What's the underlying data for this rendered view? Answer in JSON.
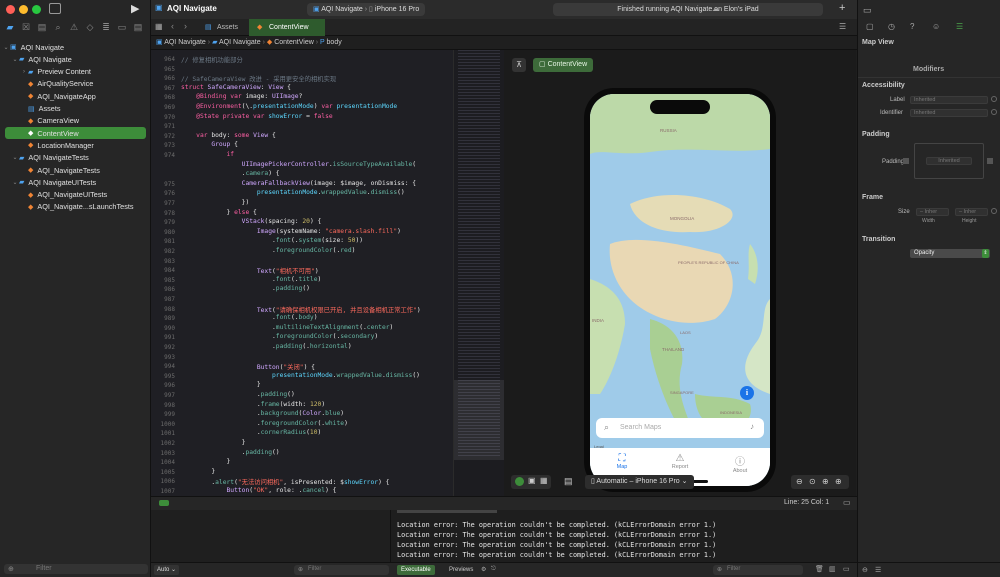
{
  "window": {
    "scheme": "AQI Navigate",
    "breadcrumb_project": "AQI Navigate",
    "device": "iPhone 16 Pro",
    "status": "Finished running AQI Navigate on Elon's iPad"
  },
  "sidebar": {
    "items": [
      {
        "label": "AQI Navigate",
        "level": 0,
        "kind": "project"
      },
      {
        "label": "AQI Navigate",
        "level": 1,
        "kind": "folder"
      },
      {
        "label": "Preview Content",
        "level": 2,
        "kind": "folder"
      },
      {
        "label": "AirQualityService",
        "level": 2,
        "kind": "swift"
      },
      {
        "label": "AQI_NavigateApp",
        "level": 2,
        "kind": "swift"
      },
      {
        "label": "Assets",
        "level": 2,
        "kind": "assets"
      },
      {
        "label": "CameraView",
        "level": 2,
        "kind": "swift"
      },
      {
        "label": "ContentView",
        "level": 2,
        "kind": "swift",
        "selected": true
      },
      {
        "label": "LocationManager",
        "level": 2,
        "kind": "swift"
      },
      {
        "label": "AQI NavigateTests",
        "level": 1,
        "kind": "folder"
      },
      {
        "label": "AQI_NavigateTests",
        "level": 2,
        "kind": "swift"
      },
      {
        "label": "AQI NavigateUITests",
        "level": 1,
        "kind": "folder"
      },
      {
        "label": "AQI_NavigateUITests",
        "level": 2,
        "kind": "swift"
      },
      {
        "label": "AQI_Navigate...sLaunchTests",
        "level": 2,
        "kind": "swift"
      }
    ],
    "filter_placeholder": "Filter"
  },
  "tabs": [
    {
      "label": "Assets"
    },
    {
      "label": "ContentView",
      "active": true
    }
  ],
  "jumpbar": [
    "AQI Navigate",
    "AQI Navigate",
    "ContentView",
    "body"
  ],
  "editor": {
    "lines": [
      {
        "n": "964",
        "html": "<span class='cm'>// 修复相机功能部分</span>"
      },
      {
        "n": "965",
        "html": ""
      },
      {
        "n": "966",
        "html": "<span class='cm'>// SafeCameraView 改进 - 采用更安全的相机实现</span>"
      },
      {
        "n": "967",
        "html": "<span class='kw'>struct</span> <span class='ty'>SafeCameraView</span>: <span class='ty'>View</span> {"
      },
      {
        "n": "968",
        "html": "    <span class='kw'>@Binding var</span> image: <span class='ty'>UIImage</span>?"
      },
      {
        "n": "969",
        "html": "    <span class='kw'>@Environment</span>(\\.<span class='pr'>presentationMode</span>) <span class='kw'>var</span> <span class='pr'>presentationMode</span>"
      },
      {
        "n": "970",
        "html": "    <span class='kw'>@State private var</span> <span class='pr'>showError</span> = <span class='kw'>false</span>"
      },
      {
        "n": "971",
        "html": ""
      },
      {
        "n": "972",
        "html": "    <span class='kw'>var</span> body: <span class='kw'>some</span> <span class='ty'>View</span> {"
      },
      {
        "n": "973",
        "html": "        <span class='ty'>Group</span> {"
      },
      {
        "n": "974",
        "html": "            <span class='kw'>if</span>"
      },
      {
        "n": "",
        "html": "                <span class='ty'>UIImagePickerController</span>.<span class='fn'>isSourceTypeAvailable</span>("
      },
      {
        "n": "",
        "html": "                .<span class='fn'>camera</span>) {"
      },
      {
        "n": "975",
        "html": "                <span class='ty'>CameraFallbackView</span>(image: $image, onDismiss: {"
      },
      {
        "n": "976",
        "html": "                    <span class='pr'>presentationMode</span>.<span class='fn'>wrappedValue</span>.<span class='fn'>dismiss</span>()"
      },
      {
        "n": "977",
        "html": "                })"
      },
      {
        "n": "978",
        "html": "            } <span class='kw'>else</span> {"
      },
      {
        "n": "979",
        "html": "                <span class='ty'>VStack</span>(spacing: <span class='nu'>20</span>) {"
      },
      {
        "n": "980",
        "html": "                    <span class='ty'>Image</span>(systemName: <span class='st'>\"camera.slash.fill\"</span>)"
      },
      {
        "n": "981",
        "html": "                        .<span class='fn'>font</span>(.<span class='fn'>system</span>(size: <span class='nu'>50</span>))"
      },
      {
        "n": "982",
        "html": "                        .<span class='fn'>foregroundColor</span>(.<span class='fn'>red</span>)"
      },
      {
        "n": "983",
        "html": ""
      },
      {
        "n": "984",
        "html": "                    <span class='ty'>Text</span>(<span class='st'>\"相机不可用\"</span>)"
      },
      {
        "n": "985",
        "html": "                        .<span class='fn'>font</span>(.<span class='fn'>title</span>)"
      },
      {
        "n": "986",
        "html": "                        .<span class='fn'>padding</span>()"
      },
      {
        "n": "987",
        "html": ""
      },
      {
        "n": "988",
        "html": "                    <span class='ty'>Text</span>(<span class='st'>\"请确保相机权限已开启, 并且设备相机正常工作\"</span>)"
      },
      {
        "n": "989",
        "html": "                        .<span class='fn'>font</span>(.<span class='fn'>body</span>)"
      },
      {
        "n": "990",
        "html": "                        .<span class='fn'>multilineTextAlignment</span>(.<span class='fn'>center</span>)"
      },
      {
        "n": "991",
        "html": "                        .<span class='fn'>foregroundColor</span>(.<span class='fn'>secondary</span>)"
      },
      {
        "n": "992",
        "html": "                        .<span class='fn'>padding</span>(.<span class='fn'>horizontal</span>)"
      },
      {
        "n": "993",
        "html": ""
      },
      {
        "n": "994",
        "html": "                    <span class='ty'>Button</span>(<span class='st'>\"关闭\"</span>) {"
      },
      {
        "n": "995",
        "html": "                        <span class='pr'>presentationMode</span>.<span class='fn'>wrappedValue</span>.<span class='fn'>dismiss</span>()"
      },
      {
        "n": "996",
        "html": "                    }"
      },
      {
        "n": "997",
        "html": "                    .<span class='fn'>padding</span>()"
      },
      {
        "n": "998",
        "html": "                    .<span class='fn'>frame</span>(width: <span class='nu'>120</span>)"
      },
      {
        "n": "999",
        "html": "                    .<span class='fn'>background</span>(<span class='ty'>Color</span>.<span class='fn'>blue</span>)"
      },
      {
        "n": "1000",
        "html": "                    .<span class='fn'>foregroundColor</span>(.<span class='fn'>white</span>)"
      },
      {
        "n": "1001",
        "html": "                    .<span class='fn'>cornerRadius</span>(<span class='nu'>10</span>)"
      },
      {
        "n": "1002",
        "html": "                }"
      },
      {
        "n": "1003",
        "html": "                .<span class='fn'>padding</span>()"
      },
      {
        "n": "1004",
        "html": "            }"
      },
      {
        "n": "1005",
        "html": "        }"
      },
      {
        "n": "1006",
        "html": "        .<span class='fn'>alert</span>(<span class='st'>\"无法访问相机\"</span>, isPresented: $<span class='pr'>showError</span>) {"
      },
      {
        "n": "1007",
        "html": "            <span class='ty'>Button</span>(<span class='st'>\"OK\"</span>, role: .<span class='fn'>cancel</span>) {"
      }
    ]
  },
  "canvas": {
    "preview_chip": "ContentView",
    "device_selector": "Automatic – iPhone 16 Pro"
  },
  "phone": {
    "labels": [
      "RUSSIA",
      "MONGOLIA",
      "PEOPLE'S REPUBLIC OF CHINA",
      "INDIA",
      "LAOS",
      "THAILAND",
      "SINGAPORE",
      "INDONESIA"
    ],
    "search_placeholder": "Search Maps",
    "legal": "Legal",
    "tabs": [
      "Map",
      "Report",
      "About"
    ]
  },
  "inspector": {
    "title": "Map View",
    "modifiers": "Modifiers",
    "accessibility": "Accessibility",
    "label": "Label",
    "identifier": "Identifier",
    "inherited": "Inherited",
    "padding_section": "Padding",
    "padding_label": "Padding",
    "frame_section": "Frame",
    "size_label": "Size",
    "inherit": "Inher",
    "width": "Width",
    "height": "Height",
    "transition_section": "Transition",
    "transition_value": "Opacity"
  },
  "status": {
    "line_col": "Line: 25  Col: 1",
    "auto": "Auto",
    "filter": "Filter",
    "executable": "Executable",
    "previews": "Previews"
  },
  "console": {
    "lines": [
      "Location error: The operation couldn't be completed. (kCLErrorDomain error 1.)",
      "Location error: The operation couldn't be completed. (kCLErrorDomain error 1.)",
      "Location error: The operation couldn't be completed. (kCLErrorDomain error 1.)",
      "Location error: The operation couldn't be completed. (kCLErrorDomain error 1.)"
    ]
  },
  "colors": {
    "accent": "#3d8d3a",
    "swift_file": "#f08434",
    "folder": "#2d8fd5"
  }
}
